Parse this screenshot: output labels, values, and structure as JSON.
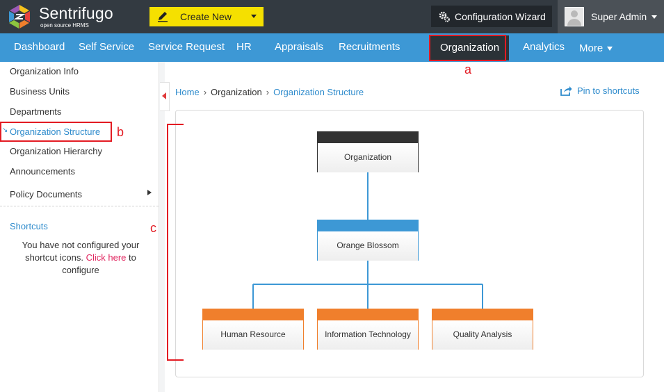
{
  "app": {
    "name": "Sentrifugo",
    "tagline": "open source HRMS"
  },
  "topbar": {
    "create_label": "Create New",
    "wizard_label": "Configuration Wizard",
    "user_name": "Super Admin"
  },
  "nav": {
    "items": [
      {
        "label": "Dashboard"
      },
      {
        "label": "Self Service"
      },
      {
        "label": "Service Request"
      },
      {
        "label": "HR"
      },
      {
        "label": "Appraisals"
      },
      {
        "label": "Recruitments"
      },
      {
        "label": "Organization"
      },
      {
        "label": "Analytics"
      },
      {
        "label": "More"
      }
    ],
    "active": "Organization"
  },
  "sidebar": {
    "items": [
      {
        "label": "Organization Info"
      },
      {
        "label": "Business Units"
      },
      {
        "label": "Departments"
      },
      {
        "label": "Organization Structure"
      },
      {
        "label": "Organization Hierarchy"
      },
      {
        "label": "Announcements"
      },
      {
        "label": "Policy Documents"
      }
    ],
    "active": "Organization Structure",
    "shortcuts_title": "Shortcuts",
    "shortcuts_msg_before": "You have not configured your shortcut icons.",
    "shortcuts_link": "Click here",
    "shortcuts_msg_after": "to configure"
  },
  "breadcrumb": {
    "home": "Home",
    "section": "Organization",
    "current": "Organization Structure"
  },
  "pin_label": "Pin to shortcuts",
  "org_chart": {
    "root": {
      "label": "Organization",
      "color": "#333333"
    },
    "unit": {
      "label": "Orange Blossom",
      "color": "#3d98d5"
    },
    "departments": [
      {
        "label": "Human Resource",
        "color": "#f07f2c"
      },
      {
        "label": "Information Technology",
        "color": "#f07f2c"
      },
      {
        "label": "Quality Analysis",
        "color": "#f07f2c"
      }
    ]
  },
  "annotations": {
    "a": "a",
    "b": "b",
    "c": "c"
  },
  "colors": {
    "accent": "#3d98d5",
    "annotation": "#e31b23",
    "create_button": "#f5e000",
    "topbar": "#333a41"
  }
}
